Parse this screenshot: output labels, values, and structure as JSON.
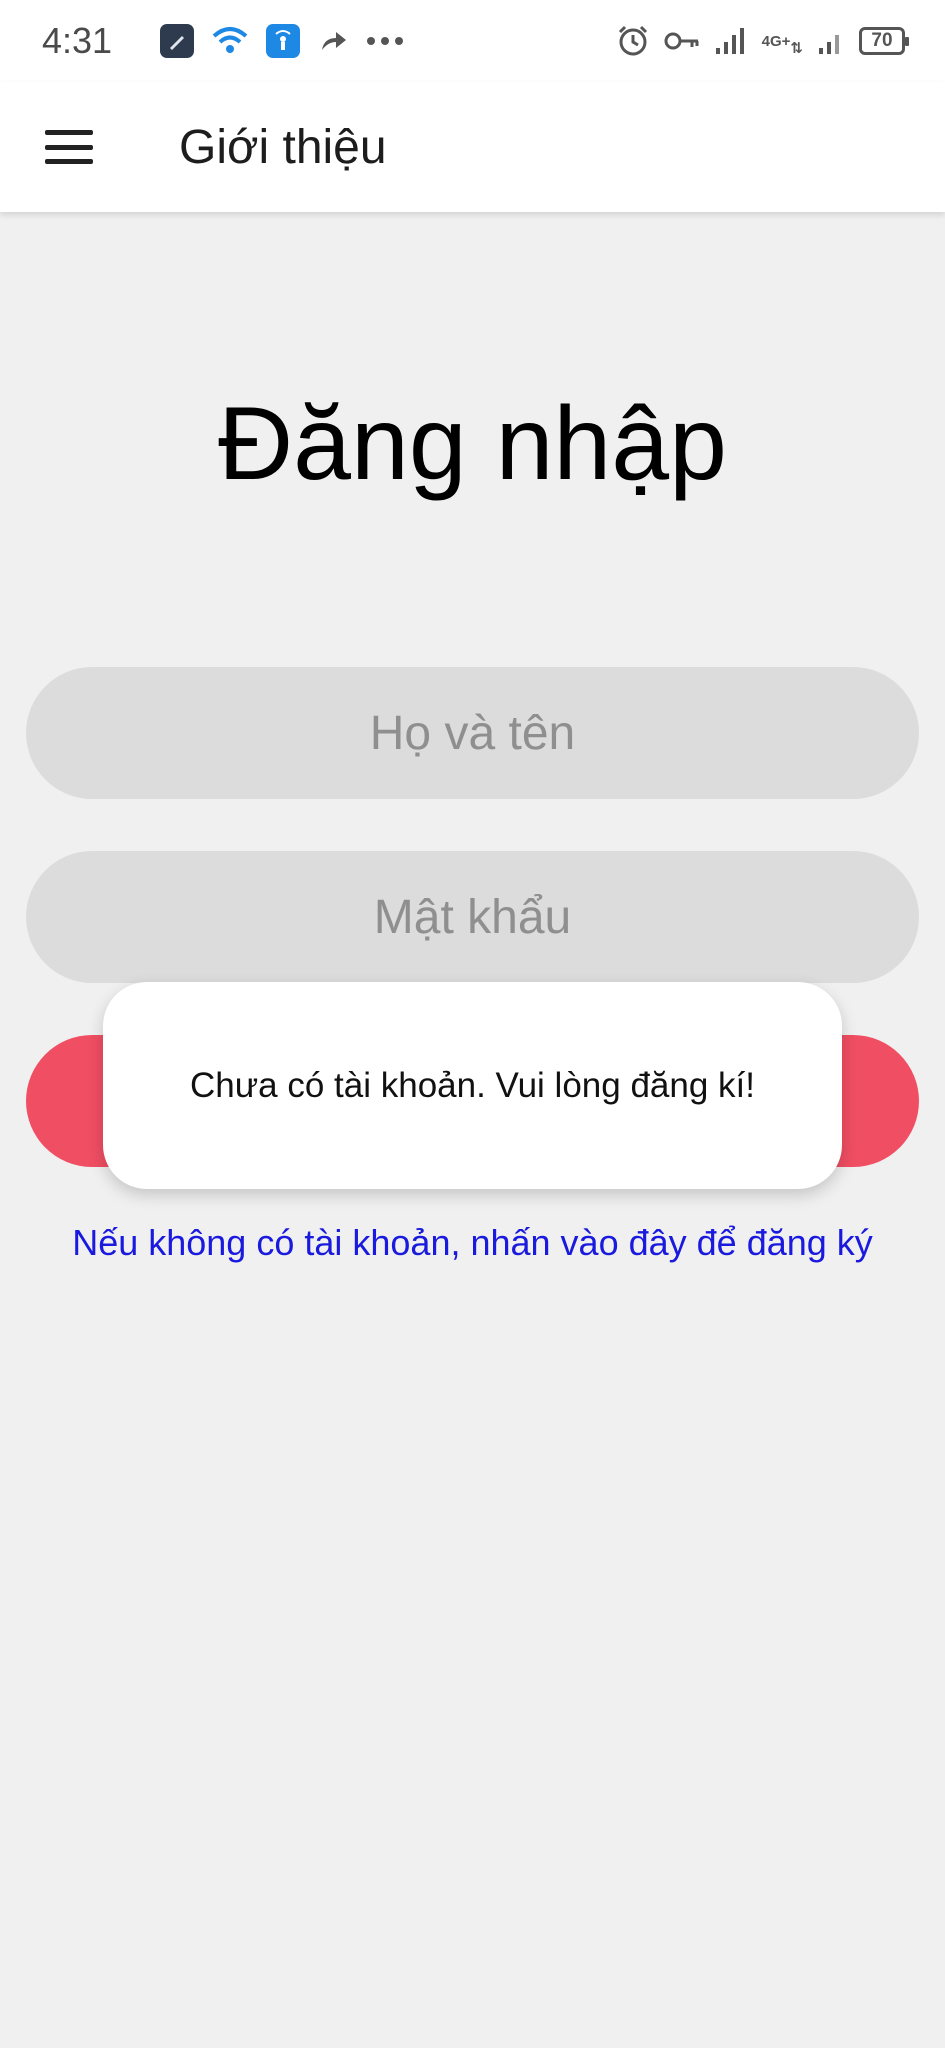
{
  "status_bar": {
    "time": "4:31",
    "battery": "70",
    "network": "4G+",
    "icons": [
      "edit-app-icon",
      "wifi-icon",
      "hotspot-app-icon",
      "share-arrow-icon",
      "more-dots-icon",
      "alarm-icon",
      "vpn-key-icon",
      "signal-icon",
      "signal-icon-2"
    ]
  },
  "app_bar": {
    "title": "Giới thiệu",
    "menu_icon": "hamburger-menu-icon"
  },
  "login": {
    "heading": "Đăng nhập",
    "name_placeholder": "Họ và tên",
    "password_placeholder": "Mật khẩu",
    "button_label": "",
    "register_link": "Nếu không có tài khoản, nhấn vào đây để đăng ký"
  },
  "toast": {
    "message": "Chưa có tài khoản. Vui lòng đăng kí!"
  },
  "colors": {
    "accent": "#f04e63",
    "background": "#f0f0f0",
    "field": "#dcdcdc",
    "link": "#1a1adf"
  }
}
